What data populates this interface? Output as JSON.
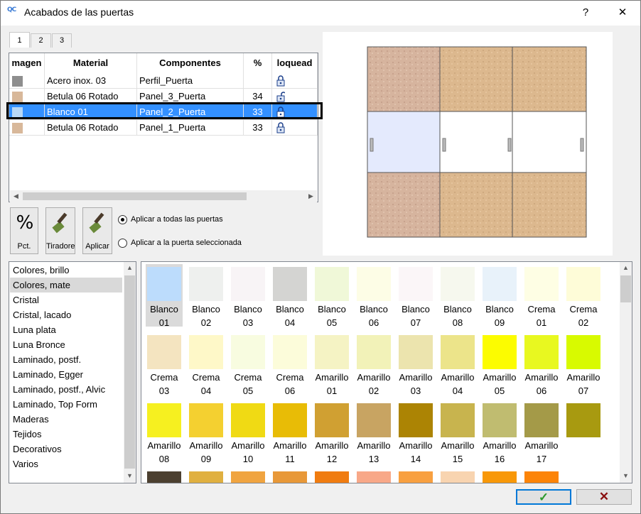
{
  "window": {
    "title": "Acabados de las puertas",
    "help": "?",
    "close": "✕"
  },
  "tabs": [
    "1",
    "2",
    "3"
  ],
  "grid": {
    "headers": [
      "magen",
      "Material",
      "Componentes",
      "%",
      "loquead"
    ],
    "rows": [
      {
        "swatch": "#8e8e8e",
        "material": "Acero inox. 03",
        "component": "Perfil_Puerta",
        "pct": "",
        "lock": "closed"
      },
      {
        "swatch": "#d8b89a",
        "material": "Betula 06 Rotado",
        "component": "Panel_3_Puerta",
        "pct": "34",
        "lock": "open"
      },
      {
        "swatch": "#b8d8f6",
        "material": "Blanco 01",
        "component": "Panel_2_Puerta",
        "pct": "33",
        "lock": "closed",
        "selected": true
      },
      {
        "swatch": "#d8b89a",
        "material": "Betula 06 Rotado",
        "component": "Panel_1_Puerta",
        "pct": "33",
        "lock": "closed"
      }
    ]
  },
  "callout": "1",
  "tools": {
    "pct": "Pct.",
    "tiradores": "Tiradores",
    "aplicar": "Aplicar"
  },
  "apply": {
    "all": "Aplicar a todas las puertas",
    "selected": "Aplicar a la puerta seleccionada"
  },
  "categories": [
    "Colores, brillo",
    "Colores, mate",
    "Cristal",
    "Cristal, lacado",
    "Luna plata",
    "Luna Bronce",
    "Laminado, postf.",
    "Laminado, Egger",
    "Laminado, postf., Alvic",
    "Laminado, Top Form",
    "Maderas",
    "Tejidos",
    "Decorativos",
    "Varios"
  ],
  "selected_category": 1,
  "colors": [
    {
      "l1": "Blanco",
      "l2": "01",
      "c": "#bcdcfc"
    },
    {
      "l1": "Blanco",
      "l2": "02",
      "c": "#eef0ee"
    },
    {
      "l1": "Blanco",
      "l2": "03",
      "c": "#f8f4f6"
    },
    {
      "l1": "Blanco",
      "l2": "04",
      "c": "#d4d4d2"
    },
    {
      "l1": "Blanco",
      "l2": "05",
      "c": "#f0f8d8"
    },
    {
      "l1": "Blanco",
      "l2": "06",
      "c": "#fdfde6"
    },
    {
      "l1": "Blanco",
      "l2": "07",
      "c": "#fbf6f8"
    },
    {
      "l1": "Blanco",
      "l2": "08",
      "c": "#f6f8ee"
    },
    {
      "l1": "Blanco",
      "l2": "09",
      "c": "#e8f2fa"
    },
    {
      "l1": "Crema",
      "l2": "01",
      "c": "#fefee4"
    },
    {
      "l1": "Crema",
      "l2": "02",
      "c": "#fefcd8"
    },
    {
      "l1": "Crema",
      "l2": "03",
      "c": "#f4e4c0"
    },
    {
      "l1": "Crema",
      "l2": "04",
      "c": "#fef8c8"
    },
    {
      "l1": "Crema",
      "l2": "05",
      "c": "#f8fce0"
    },
    {
      "l1": "Crema",
      "l2": "06",
      "c": "#fcfcda"
    },
    {
      "l1": "Amarillo",
      "l2": "01",
      "c": "#f5f3c4"
    },
    {
      "l1": "Amarillo",
      "l2": "02",
      "c": "#f2f2b8"
    },
    {
      "l1": "Amarillo",
      "l2": "03",
      "c": "#ece4ae"
    },
    {
      "l1": "Amarillo",
      "l2": "04",
      "c": "#ece48a"
    },
    {
      "l1": "Amarillo",
      "l2": "05",
      "c": "#fcfc00"
    },
    {
      "l1": "Amarillo",
      "l2": "06",
      "c": "#e8f820"
    },
    {
      "l1": "Amarillo",
      "l2": "07",
      "c": "#d8fa00"
    },
    {
      "l1": "Amarillo",
      "l2": "08",
      "c": "#f6f020"
    },
    {
      "l1": "Amarillo",
      "l2": "09",
      "c": "#f4d030"
    },
    {
      "l1": "Amarillo",
      "l2": "10",
      "c": "#f0da14"
    },
    {
      "l1": "Amarillo",
      "l2": "11",
      "c": "#e8bc06"
    },
    {
      "l1": "Amarillo",
      "l2": "12",
      "c": "#d0a032"
    },
    {
      "l1": "Amarillo",
      "l2": "13",
      "c": "#c8a462"
    },
    {
      "l1": "Amarillo",
      "l2": "14",
      "c": "#ac8404"
    },
    {
      "l1": "Amarillo",
      "l2": "15",
      "c": "#c8b44e"
    },
    {
      "l1": "Amarillo",
      "l2": "16",
      "c": "#c0bc70"
    },
    {
      "l1": "Amarillo",
      "l2": "17",
      "c": "#a49a48"
    },
    {
      "l1": "",
      "l2": "",
      "c": "#a89a10"
    },
    {
      "l1": "",
      "l2": "",
      "c": "#4c4030"
    },
    {
      "l1": "",
      "l2": "",
      "c": "#e0b040"
    },
    {
      "l1": "",
      "l2": "",
      "c": "#f0a440"
    },
    {
      "l1": "",
      "l2": "",
      "c": "#e89838"
    },
    {
      "l1": "",
      "l2": "",
      "c": "#f07c10"
    },
    {
      "l1": "",
      "l2": "",
      "c": "#f8a888"
    },
    {
      "l1": "",
      "l2": "",
      "c": "#f8a040"
    },
    {
      "l1": "",
      "l2": "",
      "c": "#f8d4b0"
    },
    {
      "l1": "",
      "l2": "",
      "c": "#f89808"
    },
    {
      "l1": "",
      "l2": "",
      "c": "#fc8408"
    }
  ],
  "buttons": {
    "ok": "✓",
    "cancel": "✕"
  },
  "accent": "#3390ff"
}
